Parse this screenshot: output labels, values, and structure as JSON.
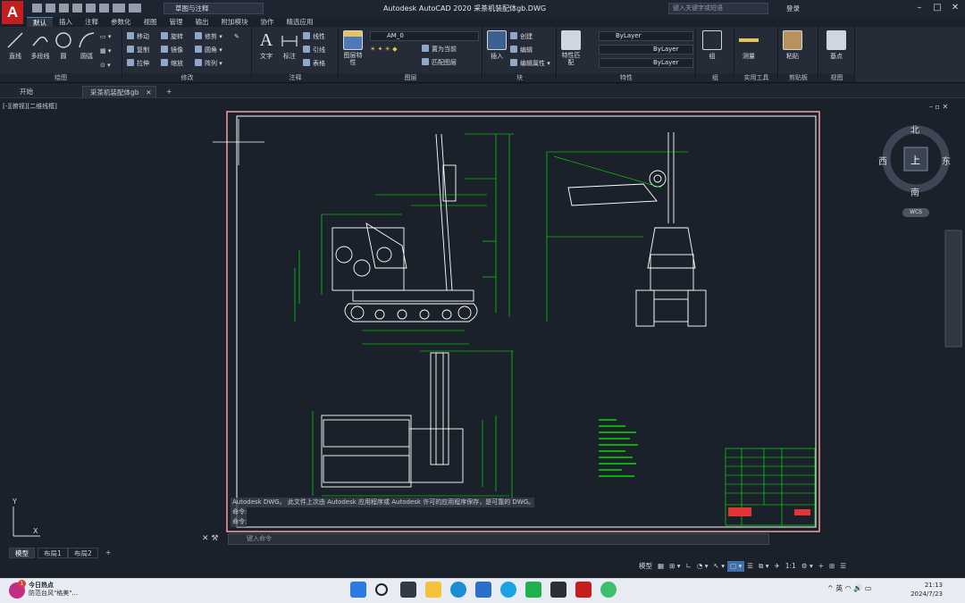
{
  "app": {
    "logo": "A",
    "title": "Autodesk AutoCAD 2020    采茶机装配体gb.DWG"
  },
  "workspace": "草图与注释",
  "search": {
    "placeholder": "键入关键字或短语"
  },
  "user": "登录",
  "ribbon_tabs": [
    "默认",
    "插入",
    "注释",
    "参数化",
    "视图",
    "管理",
    "输出",
    "附加模块",
    "协作",
    "精选应用"
  ],
  "panels": {
    "draw": {
      "title": "绘图",
      "line": "直线",
      "polyline": "多段线",
      "circle": "圆",
      "arc": "圆弧"
    },
    "modify": {
      "title": "修改",
      "move": "移动",
      "rotate": "旋转",
      "trim": "修剪",
      "copy": "复制",
      "mirror": "镜像",
      "fillet": "圆角",
      "stretch": "拉伸",
      "scale": "缩放",
      "array": "阵列"
    },
    "annotation": {
      "title": "注释",
      "text": "文字",
      "dimension": "标注",
      "linear": "线性",
      "leader": "引线",
      "table": "表格"
    },
    "layers": {
      "title": "图层",
      "props": "图层特性",
      "current": "AM_0",
      "make_current": "置为当前",
      "match": "匹配图层"
    },
    "block": {
      "title": "块",
      "insert": "插入",
      "create": "创建",
      "edit": "编辑",
      "attr": "编辑属性"
    },
    "properties": {
      "title": "特性",
      "match": "特性匹配",
      "color": "ByLayer",
      "linetype": "ByLayer",
      "lineweight": "ByLayer"
    },
    "groups": {
      "title": "组",
      "group": "组"
    },
    "utilities": {
      "title": "实用工具",
      "measure": "测量"
    },
    "clipboard": {
      "title": "剪贴板",
      "paste": "粘贴"
    },
    "view": {
      "title": "视图",
      "base": "基点"
    }
  },
  "doc_tabs": [
    "开始",
    "采茶机装配体gb"
  ],
  "viewport_label": "[-][俯视][二维线框]",
  "compass": {
    "n": "北",
    "s": "南",
    "e": "东",
    "w": "西",
    "top": "上",
    "wcs": "WCS"
  },
  "command": {
    "history": [
      "Autodesk DWG。  此文件上次由 Autodesk 应用程序或 Autodesk 许可的应用程序保存，是可靠的 DWG。",
      "命令:",
      "命令:"
    ],
    "placeholder": "键入命令"
  },
  "layout_tabs": [
    "模型",
    "布局1",
    "布局2"
  ],
  "status": {
    "model": "模型",
    "scale": "1:1"
  },
  "taskbar": {
    "news_title": "今日热点",
    "news_sub": "防范台风\"格美\"...",
    "news_badge": "1",
    "ime": "英",
    "time": "21:13",
    "date": "2024/7/23"
  },
  "colors": {
    "accent": "#c41e1e",
    "drawing_bg": "#1b212b",
    "frame": "#ff8080",
    "lines": "#ffffff",
    "dims": "#00ff00",
    "title_block": "#00ff00"
  }
}
